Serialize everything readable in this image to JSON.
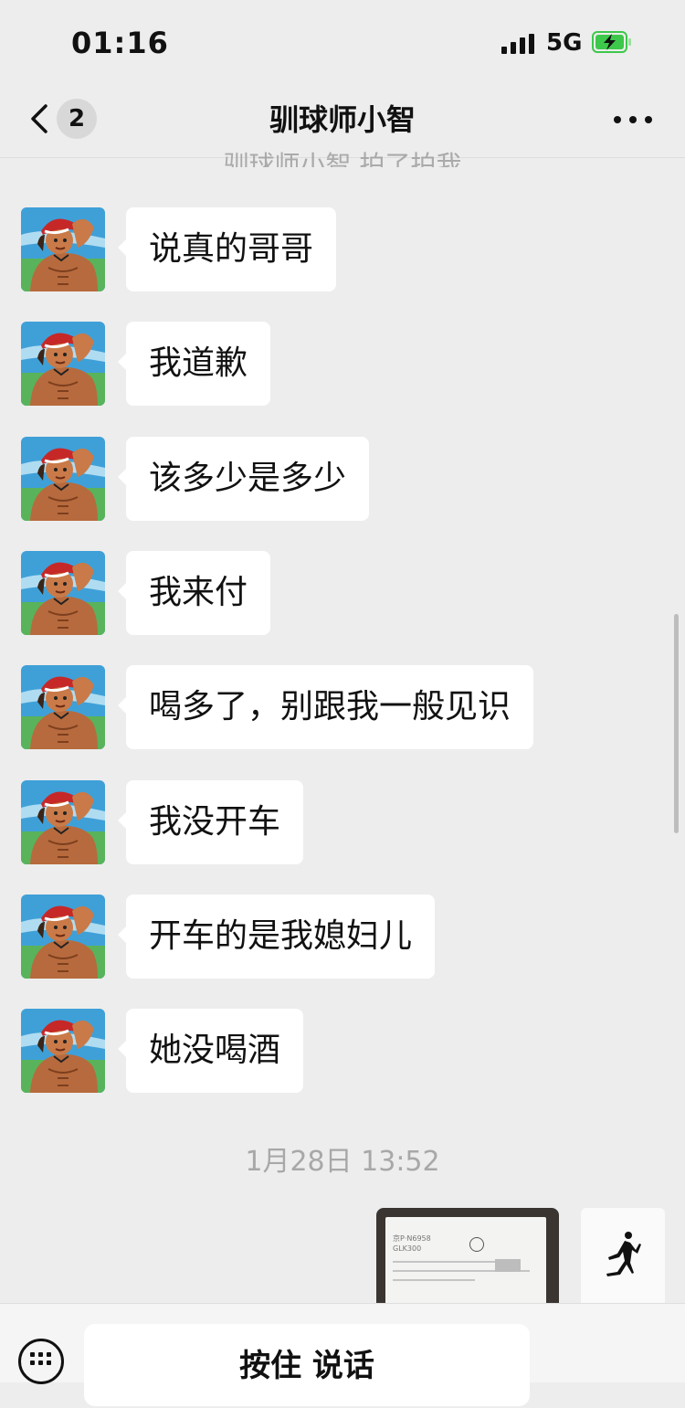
{
  "status_bar": {
    "time": "01:16",
    "network": "5G"
  },
  "nav": {
    "unread_count": "2",
    "title": "驯球师小智"
  },
  "header_cut_text": "驯球师小智 拍了拍我",
  "messages": [
    {
      "text": "说真的哥哥"
    },
    {
      "text": "我道歉"
    },
    {
      "text": "该多少是多少"
    },
    {
      "text": "我来付"
    },
    {
      "text": "喝多了，别跟我一般见识"
    },
    {
      "text": "我没开车"
    },
    {
      "text": "开车的是我媳妇儿"
    },
    {
      "text": "她没喝酒"
    }
  ],
  "timestamp": "1月28日 13:52",
  "image_message": {
    "doc_line1": "京P·N6958",
    "doc_line2": "GLK300"
  },
  "input_bar": {
    "hold_to_talk": "按住 说话"
  },
  "colors": {
    "background": "#ededed",
    "bubble": "#ffffff",
    "battery_fill": "#3dc84b"
  }
}
